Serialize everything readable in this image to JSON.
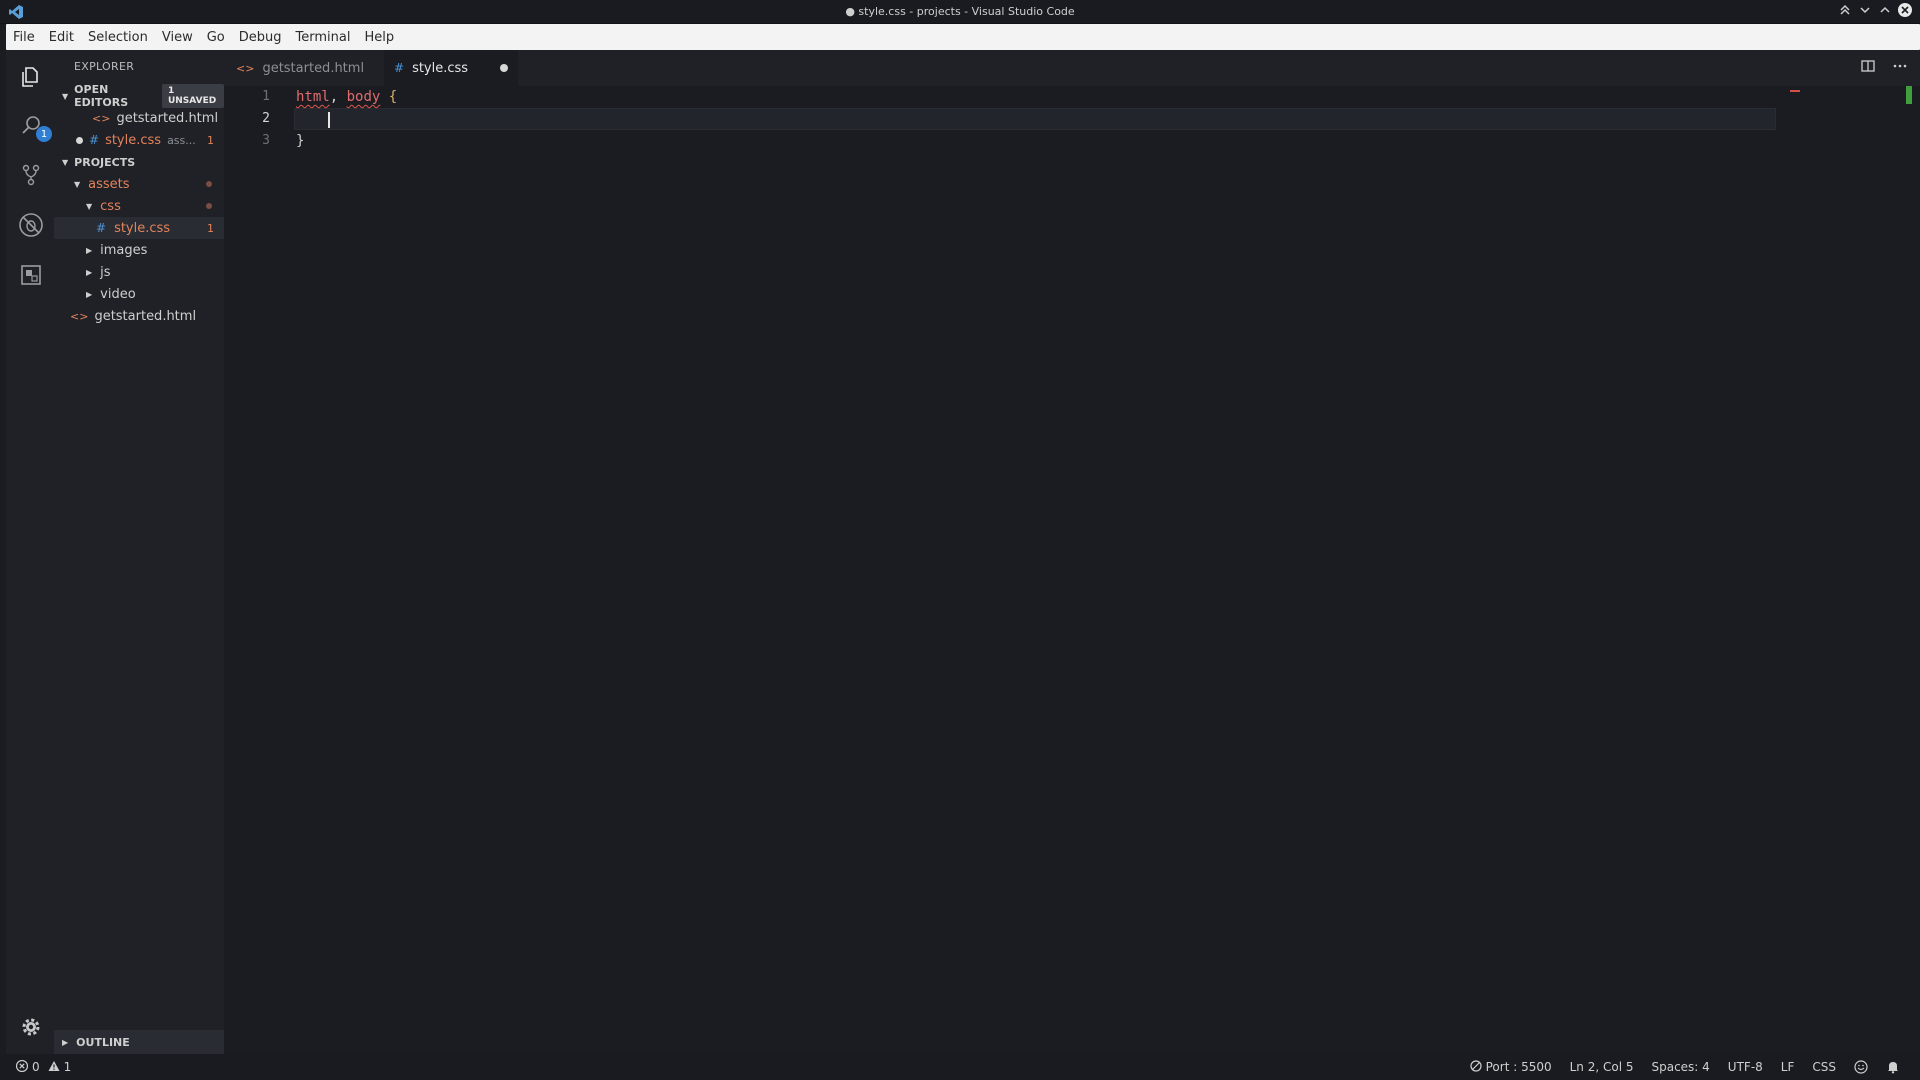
{
  "window": {
    "title": "● style.css - projects - Visual Studio Code"
  },
  "menu": [
    "File",
    "Edit",
    "Selection",
    "View",
    "Go",
    "Debug",
    "Terminal",
    "Help"
  ],
  "activity": {
    "explorer_badge": "1"
  },
  "sidebar": {
    "title": "EXPLORER",
    "open_editors": {
      "label": "OPEN EDITORS",
      "badge": "1 UNSAVED",
      "items": [
        {
          "name": "getstarted.html",
          "hint": "",
          "count": ""
        },
        {
          "name": "style.css",
          "hint": "ass...",
          "count": "1"
        }
      ]
    },
    "projects": {
      "label": "PROJECTS",
      "tree": [
        {
          "name": "assets",
          "count": ""
        },
        {
          "name": "css",
          "count": ""
        },
        {
          "name": "style.css",
          "count": "1"
        },
        {
          "name": "images",
          "count": ""
        },
        {
          "name": "js",
          "count": ""
        },
        {
          "name": "video",
          "count": ""
        },
        {
          "name": "getstarted.html",
          "count": ""
        }
      ]
    },
    "outline": "OUTLINE"
  },
  "tabs": [
    {
      "label": "getstarted.html"
    },
    {
      "label": "style.css"
    }
  ],
  "editor": {
    "line_numbers": [
      "1",
      "2",
      "3"
    ],
    "line1": {
      "selector1": "html",
      "comma": ",",
      "selector2": "body",
      "brace": "{"
    },
    "line3": "}"
  },
  "status": {
    "errors": "0",
    "warnings": "1",
    "port": "Port : 5500",
    "position": "Ln 2, Col 5",
    "spaces": "Spaces: 4",
    "encoding": "UTF-8",
    "eol": "LF",
    "language": "CSS"
  },
  "colors": {
    "accent": "#2f7fd4",
    "modified": "#e2835a",
    "error_underline": "#e0584c"
  }
}
